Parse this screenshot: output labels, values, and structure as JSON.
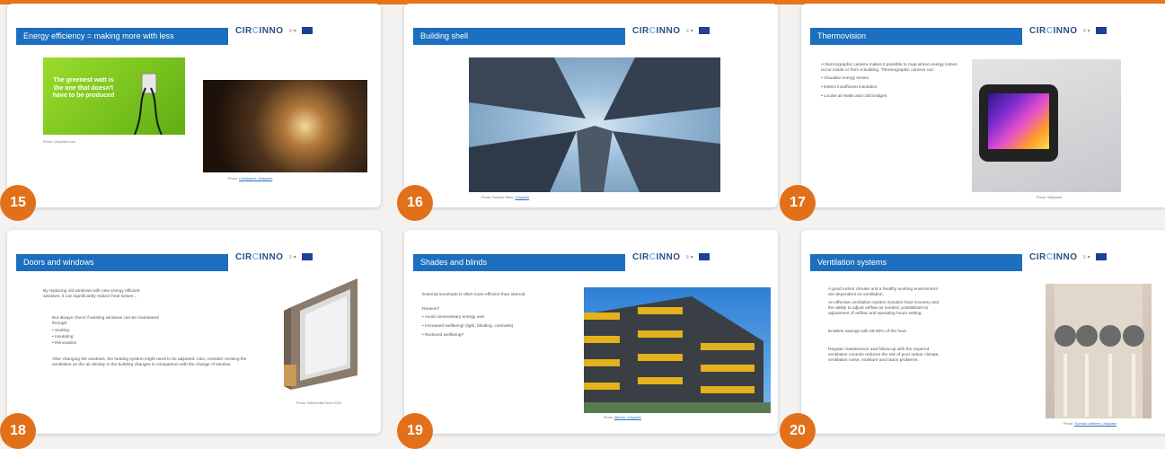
{
  "logo": {
    "brand_a": "CIR",
    "brand_o": "C",
    "brand_b": "INNO",
    "mark": "≡ ▾"
  },
  "slides": [
    {
      "number": "15",
      "title": "Energy efficiency = making more with less",
      "poster_text": "The greenest watt is the one that doesn't have to be produced",
      "caption_left": "Photo: Unsplash.com",
      "caption_right_a": "Photo: ",
      "caption_right_b": "Christopher, Unsplash"
    },
    {
      "number": "16",
      "title": "Building shell",
      "caption_a": "Photo: Samuel Zeller, ",
      "caption_b": "Unsplash"
    },
    {
      "number": "17",
      "title": "Thermovision",
      "intro": "A thermographic camera makes it possible to map where energy losses occur inside or from a building. Thermographic camera can:",
      "bullets": [
        "Visualise energy losses",
        "Detect insufficient insulation",
        "Locate air leaks and cold bridges"
      ],
      "caption": "Photo: Wikipedia"
    },
    {
      "number": "18",
      "title": "Doors and windows",
      "p1": "By replacing old windows with new energy efficient windows, it can significantly reduce heat losses...",
      "p2": "But always check if existing windows can be maintained through:",
      "bullets": [
        "Sealing",
        "Insulating",
        "Renovation"
      ],
      "p3": "After changing the windows, the heating system might need to be adjusted. Also, consider revising the ventilation as the air density in the building changes in comparison with the change of window.",
      "caption": "Photo: Wikimedia/Trend 2022"
    },
    {
      "number": "19",
      "title": "Shades and blinds",
      "p1": "External sunshade is often more efficient than internal.",
      "reason": "Reason?",
      "bullets": [
        "Avoid unnecessary energy use!",
        "Increased wellbeing! (light, blinding, contrasts)",
        "Reduced wellbeing?"
      ],
      "caption_a": "Photo: ",
      "caption_b": "Alberto, Unsplash"
    },
    {
      "number": "20",
      "title": "Ventilation systems",
      "p1": "A good indoor climate and a healthy working environment are dependent on ventilation.",
      "p2": "An effective ventilation system includes heat recovery and the ability to adjust airflow as needed, possibilities to adjustment of airflow and operating hours setting.",
      "p3": "Enables savings with 50-90% of the heat.",
      "p4": "Regular maintenance and follow-up with the required ventilation controls reduces the risk of poor indoor climate, ventilation noise, moisture and radon problems.",
      "caption_a": "Photo: ",
      "caption_b": "Tuomas Lehtinen, Unsplash"
    }
  ]
}
